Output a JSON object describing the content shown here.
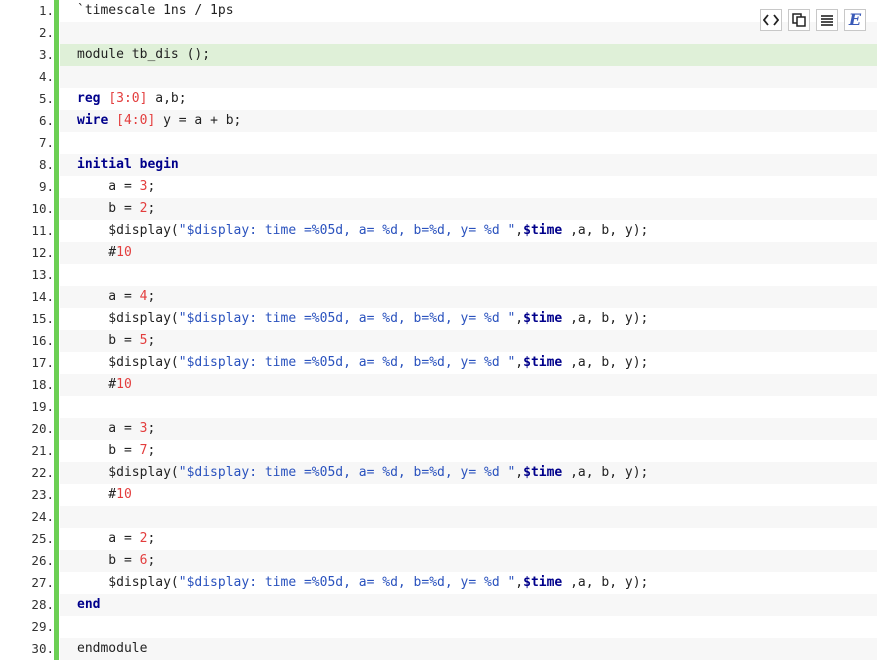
{
  "toolbar": {
    "buttons": [
      {
        "name": "view-source",
        "icon": "code-icon"
      },
      {
        "name": "copy",
        "icon": "copy-icon"
      },
      {
        "name": "print",
        "icon": "lines-icon"
      },
      {
        "name": "about",
        "icon": "e-icon",
        "label": "E"
      }
    ]
  },
  "colors": {
    "accent_bar": "#6ccf54",
    "highlight_row": "#dff0d8",
    "keyword": "#00008b",
    "number": "#e33d3d",
    "string": "#2a52be"
  },
  "code": {
    "language": "verilog",
    "highlighted_line": 3,
    "lines": [
      {
        "n": "1.",
        "tokens": [
          {
            "t": "`timescale 1ns / 1ps"
          }
        ]
      },
      {
        "n": "2.",
        "tokens": []
      },
      {
        "n": "3.",
        "tokens": [
          {
            "t": "module tb_dis ();"
          }
        ]
      },
      {
        "n": "4.",
        "tokens": []
      },
      {
        "n": "5.",
        "tokens": [
          {
            "t": "reg",
            "c": "kw"
          },
          {
            "t": " "
          },
          {
            "t": "[3:0]",
            "c": "num"
          },
          {
            "t": " a,b;"
          }
        ]
      },
      {
        "n": "6.",
        "tokens": [
          {
            "t": "wire",
            "c": "kw"
          },
          {
            "t": " "
          },
          {
            "t": "[4:0]",
            "c": "num"
          },
          {
            "t": " y = a + b;"
          }
        ]
      },
      {
        "n": "7.",
        "tokens": []
      },
      {
        "n": "8.",
        "tokens": [
          {
            "t": "initial",
            "c": "kw"
          },
          {
            "t": " "
          },
          {
            "t": "begin",
            "c": "kw"
          }
        ]
      },
      {
        "n": "9.",
        "tokens": [
          {
            "t": "    a = "
          },
          {
            "t": "3",
            "c": "num"
          },
          {
            "t": ";"
          }
        ]
      },
      {
        "n": "10.",
        "tokens": [
          {
            "t": "    b = "
          },
          {
            "t": "2",
            "c": "num"
          },
          {
            "t": ";"
          }
        ]
      },
      {
        "n": "11.",
        "tokens": [
          {
            "t": "    $display("
          },
          {
            "t": "\"$display: time =%05d, a= %d, b=%d, y= %d \"",
            "c": "str"
          },
          {
            "t": ","
          },
          {
            "t": "$time",
            "c": "sys"
          },
          {
            "t": " ,a, b, y);"
          }
        ]
      },
      {
        "n": "12.",
        "tokens": [
          {
            "t": "    #"
          },
          {
            "t": "10",
            "c": "num"
          }
        ]
      },
      {
        "n": "13.",
        "tokens": []
      },
      {
        "n": "14.",
        "tokens": [
          {
            "t": "    a = "
          },
          {
            "t": "4",
            "c": "num"
          },
          {
            "t": ";"
          }
        ]
      },
      {
        "n": "15.",
        "tokens": [
          {
            "t": "    $display("
          },
          {
            "t": "\"$display: time =%05d, a= %d, b=%d, y= %d \"",
            "c": "str"
          },
          {
            "t": ","
          },
          {
            "t": "$time",
            "c": "sys"
          },
          {
            "t": " ,a, b, y);"
          }
        ]
      },
      {
        "n": "16.",
        "tokens": [
          {
            "t": "    b = "
          },
          {
            "t": "5",
            "c": "num"
          },
          {
            "t": ";"
          }
        ]
      },
      {
        "n": "17.",
        "tokens": [
          {
            "t": "    $display("
          },
          {
            "t": "\"$display: time =%05d, a= %d, b=%d, y= %d \"",
            "c": "str"
          },
          {
            "t": ","
          },
          {
            "t": "$time",
            "c": "sys"
          },
          {
            "t": " ,a, b, y);"
          }
        ]
      },
      {
        "n": "18.",
        "tokens": [
          {
            "t": "    #"
          },
          {
            "t": "10",
            "c": "num"
          }
        ]
      },
      {
        "n": "19.",
        "tokens": []
      },
      {
        "n": "20.",
        "tokens": [
          {
            "t": "    a = "
          },
          {
            "t": "3",
            "c": "num"
          },
          {
            "t": ";"
          }
        ]
      },
      {
        "n": "21.",
        "tokens": [
          {
            "t": "    b = "
          },
          {
            "t": "7",
            "c": "num"
          },
          {
            "t": ";"
          }
        ]
      },
      {
        "n": "22.",
        "tokens": [
          {
            "t": "    $display("
          },
          {
            "t": "\"$display: time =%05d, a= %d, b=%d, y= %d \"",
            "c": "str"
          },
          {
            "t": ","
          },
          {
            "t": "$time",
            "c": "sys"
          },
          {
            "t": " ,a, b, y);"
          }
        ]
      },
      {
        "n": "23.",
        "tokens": [
          {
            "t": "    #"
          },
          {
            "t": "10",
            "c": "num"
          }
        ]
      },
      {
        "n": "24.",
        "tokens": []
      },
      {
        "n": "25.",
        "tokens": [
          {
            "t": "    a = "
          },
          {
            "t": "2",
            "c": "num"
          },
          {
            "t": ";"
          }
        ]
      },
      {
        "n": "26.",
        "tokens": [
          {
            "t": "    b = "
          },
          {
            "t": "6",
            "c": "num"
          },
          {
            "t": ";"
          }
        ]
      },
      {
        "n": "27.",
        "tokens": [
          {
            "t": "    $display("
          },
          {
            "t": "\"$display: time =%05d, a= %d, b=%d, y= %d \"",
            "c": "str"
          },
          {
            "t": ","
          },
          {
            "t": "$time",
            "c": "sys"
          },
          {
            "t": " ,a, b, y);"
          }
        ]
      },
      {
        "n": "28.",
        "tokens": [
          {
            "t": "end",
            "c": "kw"
          }
        ]
      },
      {
        "n": "29.",
        "tokens": []
      },
      {
        "n": "30.",
        "tokens": [
          {
            "t": "endmodule"
          }
        ]
      }
    ]
  }
}
